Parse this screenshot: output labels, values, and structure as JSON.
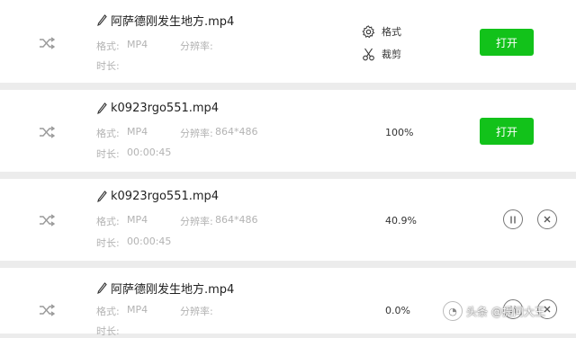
{
  "labels": {
    "format": "格式:",
    "resolution": "分辨率:",
    "duration": "时长:"
  },
  "rows": [
    {
      "title": "阿萨德刚发生地方.mp4",
      "format": "MP4",
      "resolution": "",
      "duration": "",
      "format_option": "格式",
      "crop_option": "裁剪",
      "open_label": "打开"
    },
    {
      "title": "k0923rgo551.mp4",
      "format": "MP4",
      "resolution": "864*486",
      "duration": "00:00:45",
      "progress": "100%",
      "open_label": "打开"
    },
    {
      "title": "k0923rgo551.mp4",
      "format": "MP4",
      "resolution": "864*486",
      "duration": "00:00:45",
      "progress": "40.9%"
    },
    {
      "title": "阿萨德刚发生地方.mp4",
      "format": "MP4",
      "resolution": "",
      "duration": "",
      "progress": "0.0%"
    }
  ],
  "watermark": "头条 @提问大王",
  "colors": {
    "open_button": "#12c21a",
    "background": "#ececec",
    "meta_text": "#b3b3b3"
  },
  "icons": [
    "shuffle-icon",
    "pencil-icon",
    "gear-icon",
    "scissors-icon",
    "pause-icon",
    "close-icon"
  ]
}
